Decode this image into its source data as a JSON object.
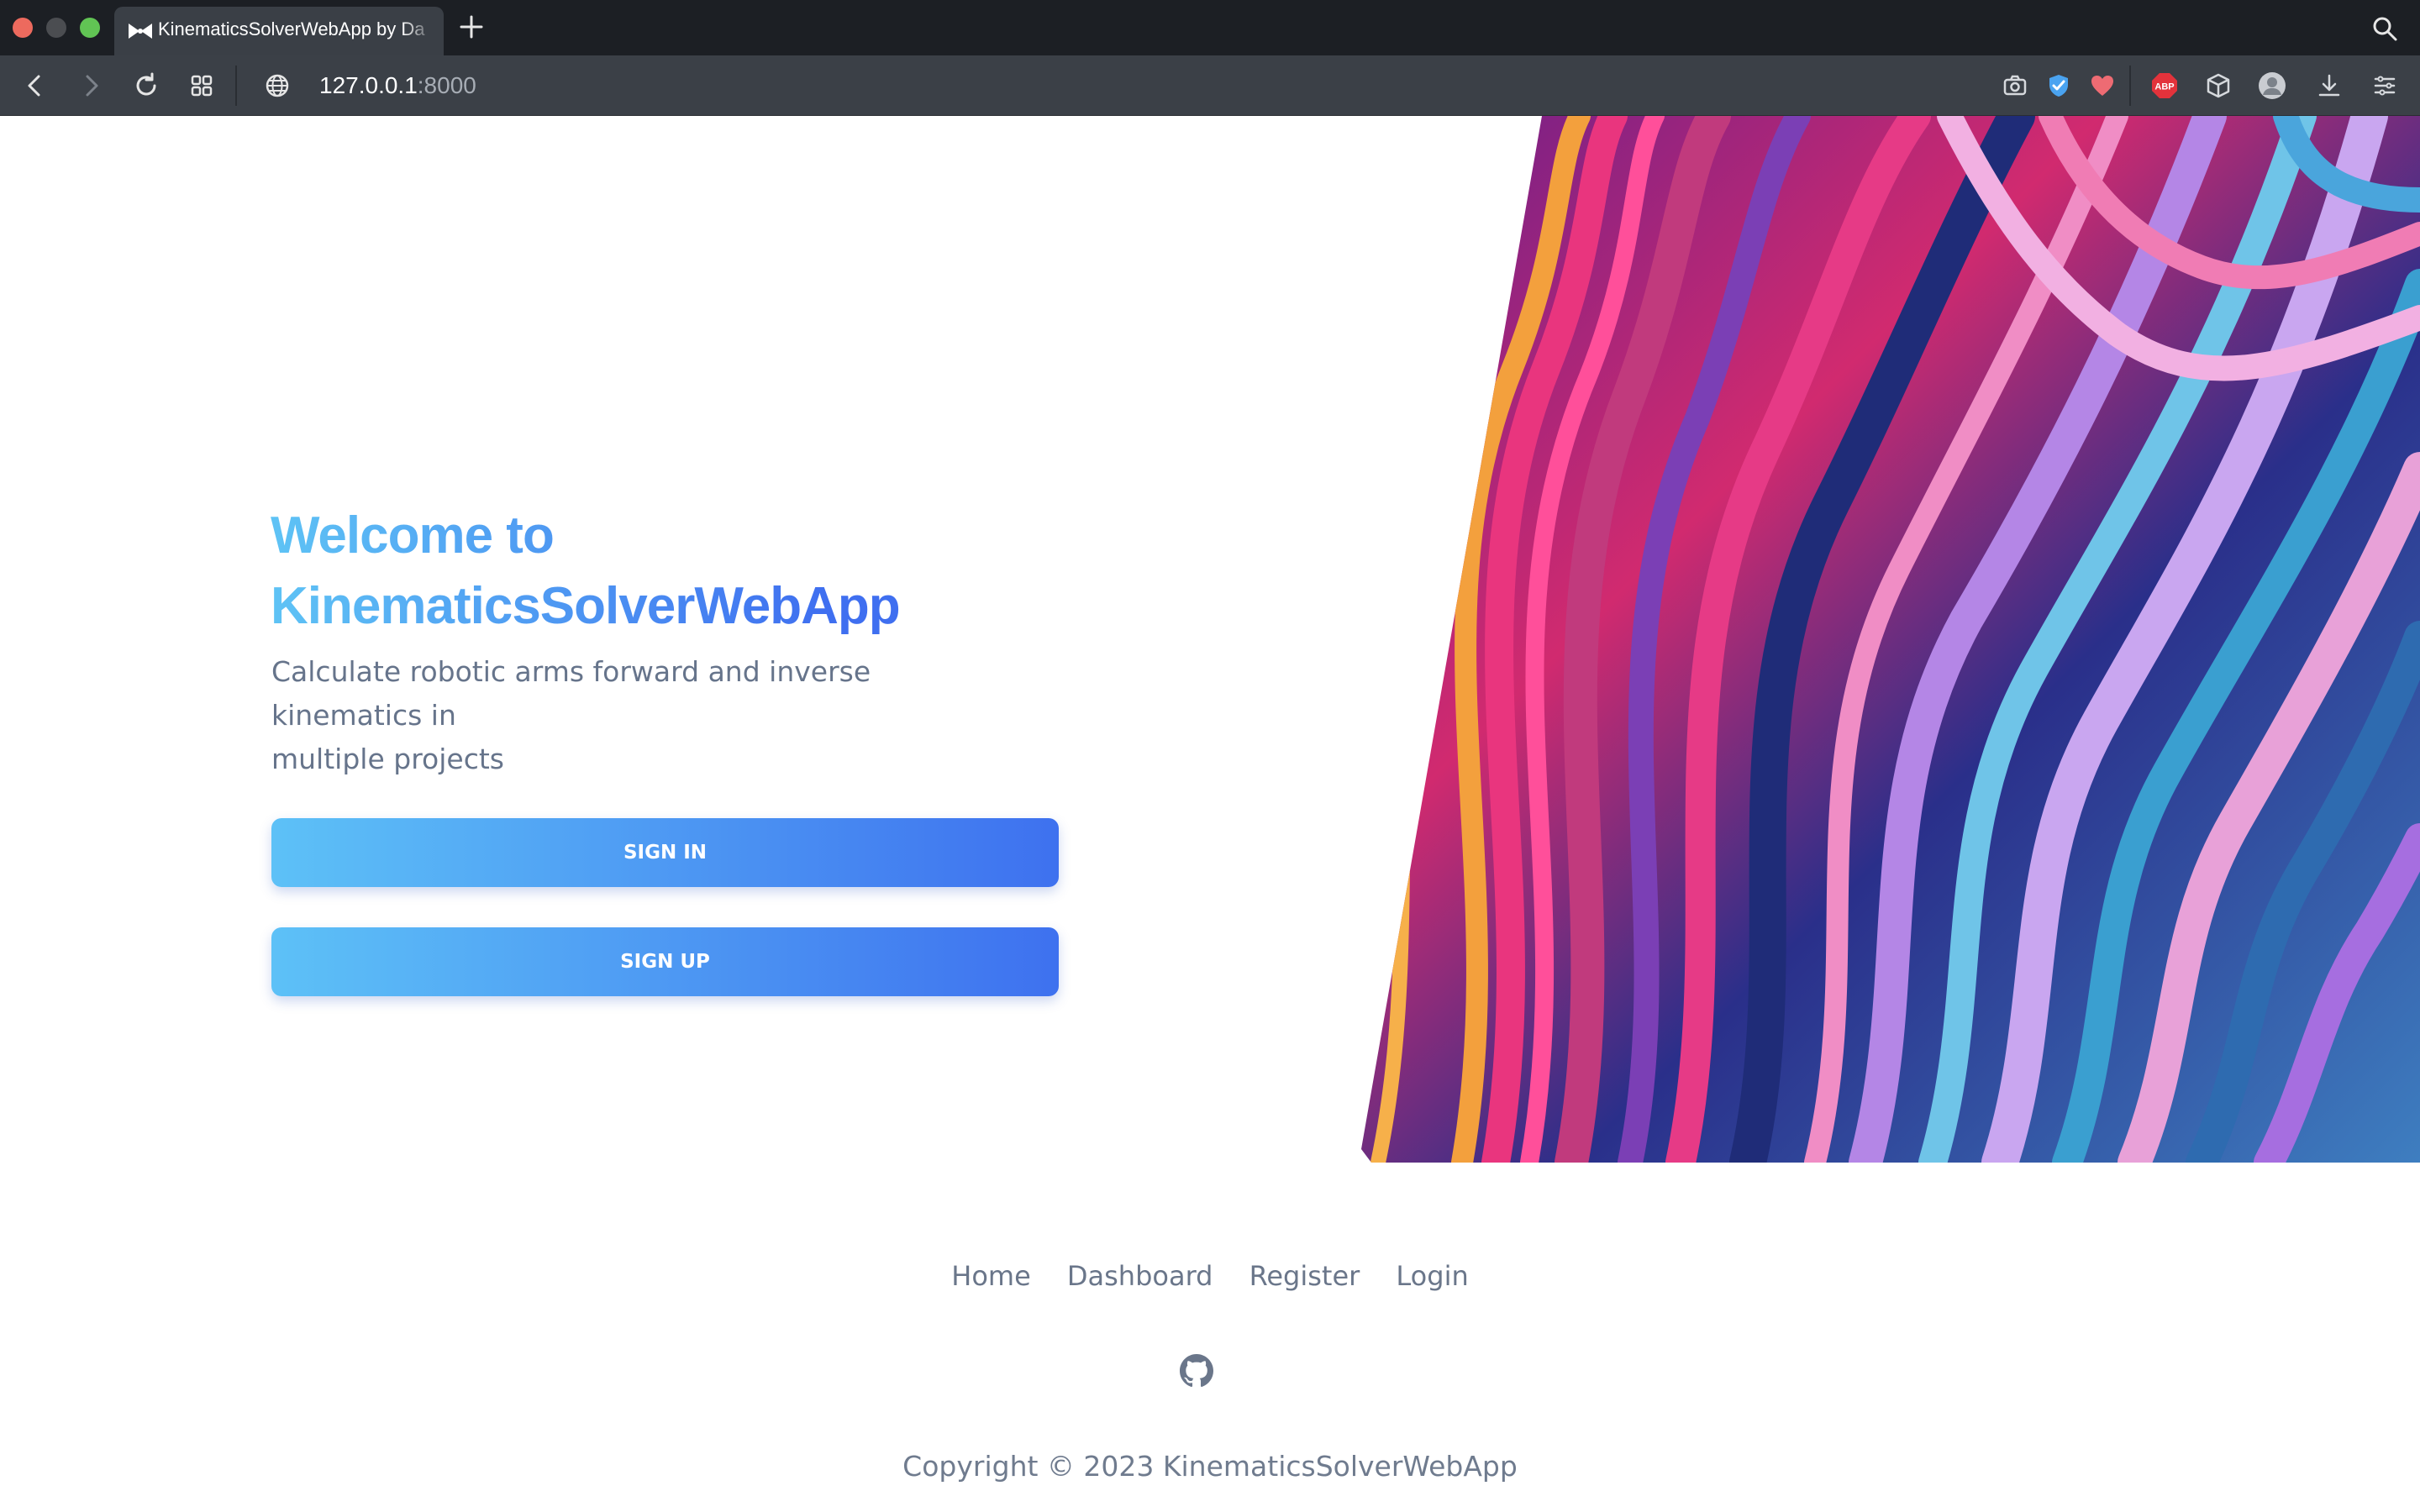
{
  "browser": {
    "tab_title": "KinematicsSolverWebApp by Da",
    "url_host": "127.0.0.1",
    "url_port": ":8000",
    "extensions": [
      "camera-icon",
      "shield-check-icon",
      "heart-icon",
      "adblock-icon",
      "cube-icon",
      "profile-icon",
      "download-icon",
      "menu-icon"
    ]
  },
  "hero": {
    "title_line1": "Welcome to",
    "title_line2": "KinematicsSolverWebApp",
    "subtitle_line1": "Calculate robotic arms forward and inverse kinematics in",
    "subtitle_line2": "multiple projects",
    "signin_label": "SIGN IN",
    "signup_label": "SIGN UP"
  },
  "footer": {
    "links": [
      "Home",
      "Dashboard",
      "Register",
      "Login"
    ],
    "copyright": "Copyright © 2023 KinematicsSolverWebApp"
  },
  "colors": {
    "gradient_start": "#5ec3f5",
    "gradient_end": "#3f6ff0",
    "chrome_dark": "#1c1f24",
    "addressbar": "#3b4047"
  }
}
